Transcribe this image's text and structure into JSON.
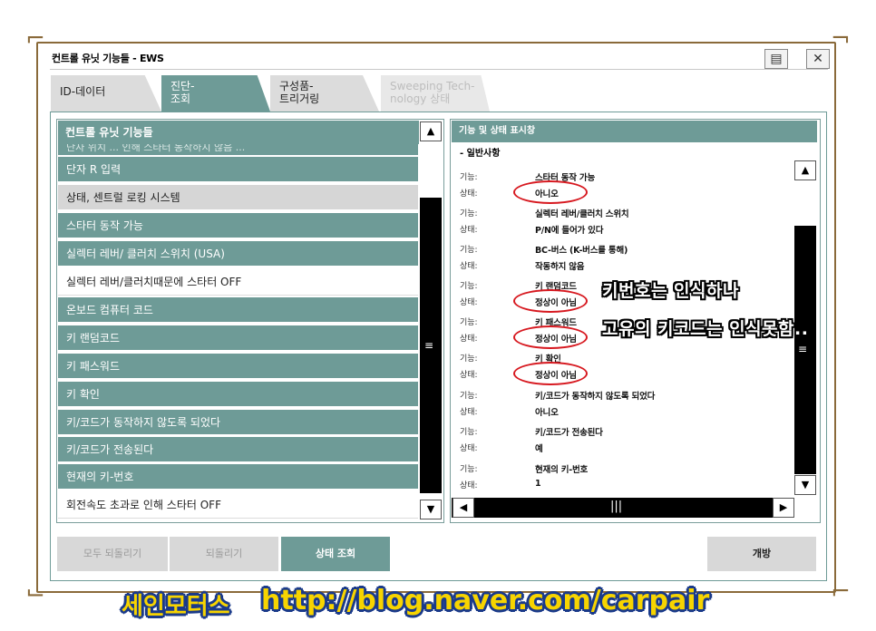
{
  "window": {
    "title": "컨트롤 유닛 기능들 - EWS",
    "print_icon": "printer-icon",
    "close_icon": "close-icon"
  },
  "tabs": [
    {
      "label_line1": "ID-데이터",
      "label_line2": "",
      "state": "inactive"
    },
    {
      "label_line1": "진단-",
      "label_line2": "조회",
      "state": "active"
    },
    {
      "label_line1": "구성품-",
      "label_line2": "트리거링",
      "state": "inactive"
    },
    {
      "label_line1": "Sweeping Tech-",
      "label_line2": "nology 상태",
      "state": "disabled"
    }
  ],
  "left_list": {
    "header": "컨트롤 유닛 기능들",
    "partial_row": "단자 위치 ... 인해 스타터 동작하지 않음 ...",
    "items": [
      {
        "label": "단자 R 입력",
        "style": "teal"
      },
      {
        "label": "상태, 센트럴 로킹 시스템",
        "style": "grey"
      },
      {
        "label": "스타터 동작 가능",
        "style": "teal"
      },
      {
        "label": "실렉터 레버/ 클러치 스위치 (USA)",
        "style": "teal"
      },
      {
        "label": "실렉터 레버/클러치때문에 스타터 OFF",
        "style": "white"
      },
      {
        "label": "온보드 컴퓨터 코드",
        "style": "teal"
      },
      {
        "label": "키 랜덤코드",
        "style": "teal"
      },
      {
        "label": "키 패스워드",
        "style": "teal"
      },
      {
        "label": "키 확인",
        "style": "teal"
      },
      {
        "label": "키/코드가 동작하지 않도록 되었다",
        "style": "teal"
      },
      {
        "label": "키/코드가 전송된다",
        "style": "teal"
      },
      {
        "label": "현재의 키-번호",
        "style": "teal"
      },
      {
        "label": "회전속도 초과로 인해 스타터 OFF",
        "style": "white"
      }
    ]
  },
  "right_panel": {
    "header": "기능 및 상태 표시창",
    "section": "- 일반사항",
    "entries": [
      {
        "func_label": "기능:",
        "func": "스타터 동작 가능",
        "state_label": "상태:",
        "state": "아니오",
        "circled": true
      },
      {
        "func_label": "기능:",
        "func": "실렉터 레버/클러치 스위치",
        "state_label": "상태:",
        "state": "P/N에 들어가 있다",
        "circled": false
      },
      {
        "func_label": "기능:",
        "func": "BC-버스 (K-버스를 통해)",
        "state_label": "상태:",
        "state": "작동하지 않음",
        "circled": false
      },
      {
        "func_label": "기능:",
        "func": "키 랜덤코드",
        "state_label": "상태:",
        "state": "정상이 아님",
        "circled": true
      },
      {
        "func_label": "기능:",
        "func": "키 패스워드",
        "state_label": "상태:",
        "state": "정상이 아님",
        "circled": true
      },
      {
        "func_label": "기능:",
        "func": "키 확인",
        "state_label": "상태:",
        "state": "정상이 아님",
        "circled": true
      },
      {
        "func_label": "기능:",
        "func": "키/코드가 동작하지 않도록 되었다",
        "state_label": "상태:",
        "state": "아니오",
        "circled": false
      },
      {
        "func_label": "기능:",
        "func": "키/코드가 전송된다",
        "state_label": "상태:",
        "state": "예",
        "circled": false
      },
      {
        "func_label": "기능:",
        "func": "현재의 키-번호",
        "state_label": "상태:",
        "state": "1",
        "circled": false
      }
    ]
  },
  "buttons": {
    "reset_all": "모두 되돌리기",
    "reset": "되돌리기",
    "status_query": "상태 조회",
    "open": "개방"
  },
  "annotation": {
    "line1": "키번호는 인식하나",
    "line2": "고유의 키코드는 인식못함.."
  },
  "watermark": {
    "name": "세인모터스",
    "url": "http://blog.naver.com/carpair"
  },
  "colors": {
    "accent": "#6e9b97",
    "highlight_circle": "#d71920",
    "watermark_yellow": "#f7d400",
    "watermark_outline": "#1a3a8a"
  }
}
